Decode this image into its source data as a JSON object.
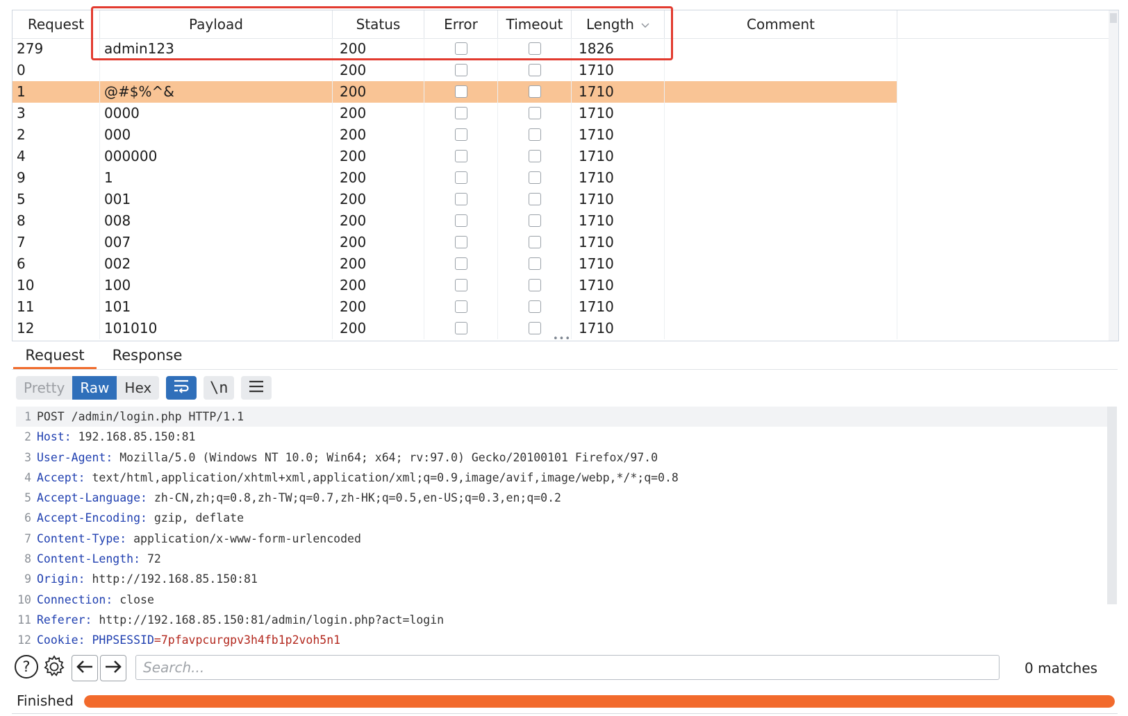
{
  "columns": [
    "Request",
    "Payload",
    "Status",
    "Error",
    "Timeout",
    "Length",
    "Comment"
  ],
  "rows": [
    {
      "request": "279",
      "payload": "admin123",
      "status": "200",
      "length": "1826",
      "selected": false
    },
    {
      "request": "0",
      "payload": "",
      "status": "200",
      "length": "1710",
      "selected": false
    },
    {
      "request": "1",
      "payload": "@#$%^&",
      "status": "200",
      "length": "1710",
      "selected": true
    },
    {
      "request": "3",
      "payload": "0000",
      "status": "200",
      "length": "1710",
      "selected": false
    },
    {
      "request": "2",
      "payload": "000",
      "status": "200",
      "length": "1710",
      "selected": false
    },
    {
      "request": "4",
      "payload": "000000",
      "status": "200",
      "length": "1710",
      "selected": false
    },
    {
      "request": "9",
      "payload": "1",
      "status": "200",
      "length": "1710",
      "selected": false
    },
    {
      "request": "5",
      "payload": "001",
      "status": "200",
      "length": "1710",
      "selected": false
    },
    {
      "request": "8",
      "payload": "008",
      "status": "200",
      "length": "1710",
      "selected": false
    },
    {
      "request": "7",
      "payload": "007",
      "status": "200",
      "length": "1710",
      "selected": false
    },
    {
      "request": "6",
      "payload": "002",
      "status": "200",
      "length": "1710",
      "selected": false
    },
    {
      "request": "10",
      "payload": "100",
      "status": "200",
      "length": "1710",
      "selected": false
    },
    {
      "request": "11",
      "payload": "101",
      "status": "200",
      "length": "1710",
      "selected": false
    },
    {
      "request": "12",
      "payload": "101010",
      "status": "200",
      "length": "1710",
      "selected": false
    }
  ],
  "sort_indicator": "chevron-down-icon",
  "tabs": {
    "request": "Request",
    "response": "Response",
    "active": "request"
  },
  "toolbar": {
    "pretty": "Pretty",
    "raw": "Raw",
    "hex": "Hex",
    "newline": "\\n",
    "active": "raw"
  },
  "editor_lines": [
    {
      "num": "1",
      "key": "",
      "value": "POST /admin/login.php HTTP/1.1"
    },
    {
      "num": "2",
      "key": "Host:",
      "value": " 192.168.85.150:81"
    },
    {
      "num": "3",
      "key": "User-Agent:",
      "value": " Mozilla/5.0 (Windows NT 10.0; Win64; x64; rv:97.0) Gecko/20100101 Firefox/97.0"
    },
    {
      "num": "4",
      "key": "Accept:",
      "value": " text/html,application/xhtml+xml,application/xml;q=0.9,image/avif,image/webp,*/*;q=0.8"
    },
    {
      "num": "5",
      "key": "Accept-Language:",
      "value": " zh-CN,zh;q=0.8,zh-TW;q=0.7,zh-HK;q=0.5,en-US;q=0.3,en;q=0.2"
    },
    {
      "num": "6",
      "key": "Accept-Encoding:",
      "value": " gzip, deflate"
    },
    {
      "num": "7",
      "key": "Content-Type:",
      "value": " application/x-www-form-urlencoded"
    },
    {
      "num": "8",
      "key": "Content-Length:",
      "value": " 72"
    },
    {
      "num": "9",
      "key": "Origin:",
      "value": " http://192.168.85.150:81"
    },
    {
      "num": "10",
      "key": "Connection:",
      "value": " close"
    },
    {
      "num": "11",
      "key": "Referer:",
      "value": " http://192.168.85.150:81/admin/login.php?act=login"
    },
    {
      "num": "12",
      "key": "Cookie:",
      "value": " PHPSESSID",
      "cookie_value": "=7pfavpcurgpv3h4fb1p2voh5n1"
    }
  ],
  "search": {
    "placeholder": "Search...",
    "value": "",
    "matches": "0 matches"
  },
  "status": {
    "text": "Finished",
    "progress": 1.0
  },
  "colors": {
    "highlight_border": "#e23a2e",
    "selected_row": "#f9c495",
    "accent": "#f26a2c",
    "active_button": "#2f6fba",
    "header_key": "#1f3fb0",
    "cookie_value": "#b3281e"
  }
}
